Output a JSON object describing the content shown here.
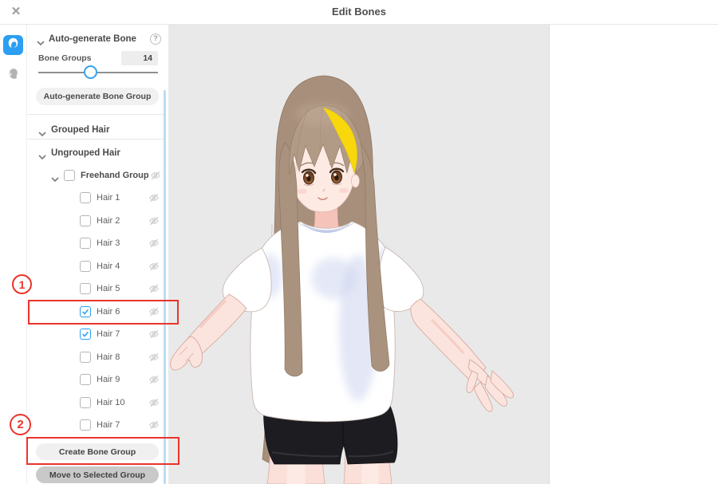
{
  "header": {
    "title": "Edit Bones",
    "close_icon": "✕"
  },
  "rail": {
    "tools": [
      {
        "name": "hair-tool",
        "selected": true
      },
      {
        "name": "face-tool",
        "selected": false
      }
    ]
  },
  "panel": {
    "auto_generate": {
      "title": "Auto-generate Bone",
      "help": "?",
      "bone_groups_label": "Bone Groups",
      "bone_groups_value": "14",
      "slider_percent": 43,
      "button": "Auto-generate Bone Group"
    },
    "grouped_section": "Grouped Hair",
    "ungrouped_section": "Ungrouped Hair",
    "tree": {
      "group": {
        "label": "Freehand Group",
        "checked": false
      },
      "items": [
        {
          "label": "Hair 1",
          "checked": false
        },
        {
          "label": "Hair 2",
          "checked": false
        },
        {
          "label": "Hair 3",
          "checked": false
        },
        {
          "label": "Hair 4",
          "checked": false
        },
        {
          "label": "Hair 5",
          "checked": false
        },
        {
          "label": "Hair 6",
          "checked": true
        },
        {
          "label": "Hair 7",
          "checked": true
        },
        {
          "label": "Hair 8",
          "checked": false
        },
        {
          "label": "Hair 9",
          "checked": false
        },
        {
          "label": "Hair 10",
          "checked": false
        },
        {
          "label": "Hair 7",
          "checked": false
        }
      ]
    },
    "create_button": "Create Bone Group",
    "move_button": "Move to Selected Group"
  },
  "annotations": {
    "step1": "1",
    "step2": "2",
    "highlight_color": "#ea342b"
  },
  "colors": {
    "accent_blue": "#2b9ff2",
    "scrollbar_blue": "#b8ddf6",
    "viewport_bg": "#e9e9e9",
    "hair_brown": "#a78f7b",
    "hair_highlight_yellow": "#f8d70d",
    "shirt_white": "#ffffff",
    "shorts_black": "#1c1c21"
  }
}
